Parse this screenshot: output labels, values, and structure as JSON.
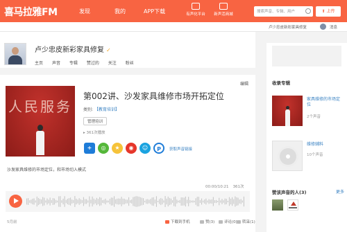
{
  "header": {
    "logo": "喜马拉雅FM",
    "nav": [
      "发现",
      "我的",
      "APP下载"
    ],
    "tools": [
      {
        "label": "有声化平台",
        "icon": "mic-icon"
      },
      {
        "label": "新声活商城",
        "icon": "shop-icon"
      }
    ],
    "search_placeholder": "搜索声音、专辑、用户",
    "upload_label": "上传"
  },
  "subbar": {
    "username": "卢少忠皮新彩家具修复",
    "messages_label": "消息"
  },
  "profile": {
    "name": "卢少忠皮新彩家具修复",
    "tabs": [
      "主页",
      "声音",
      "专辑",
      "赞过的",
      "关注",
      "粉丝"
    ]
  },
  "track": {
    "edit_label": "编辑",
    "cover_text": "人民服务",
    "title": "第002讲、沙发家具维修市场开拓定位",
    "category_label": "类别:",
    "category": "【教育培训】",
    "tag": "管理培训",
    "plays": "361次播放",
    "share_link_label": "获取声音链接",
    "description": "沙发家具维修的市场定位，和市场切入模式",
    "time": "00:00/10:21",
    "play_count": "361次",
    "date": "5月前",
    "actions": {
      "download": "下载到手机",
      "like": "赞(3)",
      "comment": "评论(0)",
      "forward": "转采(1)"
    }
  },
  "sidebar": {
    "albums_title": "收录专辑",
    "albums": [
      {
        "title": "家具维修的市场定位",
        "count": "2个声音"
      },
      {
        "title": "维修辅料",
        "count": "10个声音"
      }
    ],
    "likers_title": "赞该声音的人(3)",
    "more_label": "更多"
  },
  "colors": {
    "brand": "#f86442",
    "link": "#3b83c3"
  }
}
